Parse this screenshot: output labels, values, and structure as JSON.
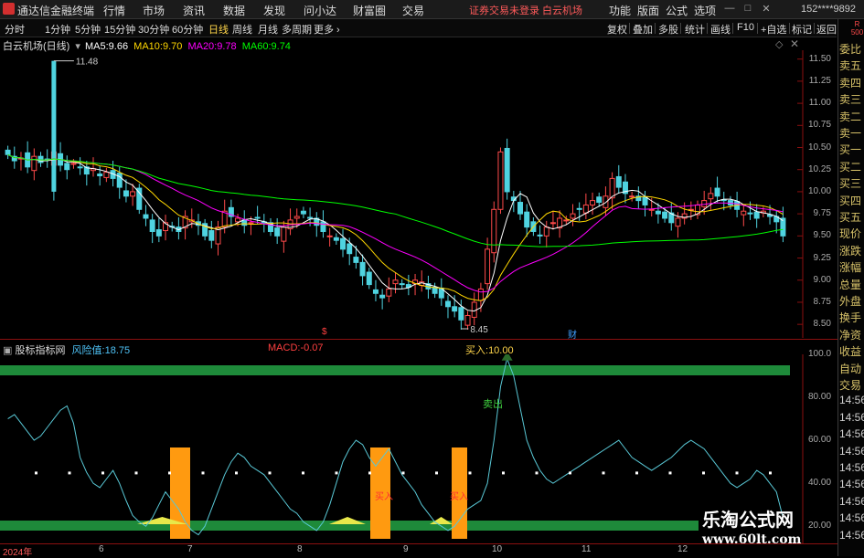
{
  "app": {
    "title": "通达信金融终端",
    "menu": [
      "行情",
      "市场",
      "资讯",
      "数据",
      "发现",
      "问小达",
      "财富圈",
      "交易"
    ],
    "notice": "证券交易未登录  白云机场",
    "right_menu": [
      "功能",
      "版面",
      "公式",
      "选项"
    ],
    "phone": "152****9892",
    "window_buttons": [
      "—",
      "□",
      "✕"
    ]
  },
  "toolbar": {
    "periods": [
      "分时",
      "1分钟",
      "5分钟",
      "15分钟",
      "30分钟",
      "60分钟",
      "日线",
      "周线",
      "月线",
      "多周期",
      "更多 ›"
    ],
    "active_period": "日线",
    "right_buttons": [
      "复权",
      "叠加",
      "多股",
      "统计",
      "画线",
      "F10",
      "+自选",
      "标记",
      "返回"
    ]
  },
  "main_chart": {
    "stock_label": "白云机场(日线)",
    "ma": [
      {
        "label": "MA5:",
        "value": "9.66",
        "color": "#ffffff"
      },
      {
        "label": "MA10:",
        "value": "9.70",
        "color": "#ffd700"
      },
      {
        "label": "MA20:",
        "value": "9.78",
        "color": "#ff00ff"
      },
      {
        "label": "MA60:",
        "value": "9.74",
        "color": "#00ff00"
      }
    ],
    "high_marker": "11.48",
    "low_marker": "8.45",
    "event_markers": [
      "$",
      "财"
    ]
  },
  "indicator_panel": {
    "title": "股标指标网",
    "risk_label": "风险值:",
    "risk_value": "18.75",
    "macd_label": "MACD:",
    "macd_value": "-0.07",
    "buy_label": "买入:",
    "buy_value": "10.00",
    "annotations": {
      "sell": "卖出",
      "buy": "买入"
    }
  },
  "right_panel": {
    "badge": [
      "R",
      "500"
    ],
    "labels": [
      "委比",
      "卖五",
      "卖四",
      "卖三",
      "卖二",
      "卖一",
      "买一",
      "买二",
      "买三",
      "买四",
      "买五",
      "现价",
      "涨跌",
      "涨幅",
      "总量",
      "外盘",
      "换手",
      "净资",
      "收益",
      "自动",
      "交易",
      "14:56",
      "14:56",
      "14:56",
      "14:56",
      "14:56",
      "14:56",
      "14:56",
      "14:56",
      "14:56"
    ]
  },
  "y_axis_main": [
    "11.50",
    "11.25",
    "11.00",
    "10.75",
    "10.50",
    "10.25",
    "10.00",
    "9.75",
    "9.50",
    "9.25",
    "9.00",
    "8.75",
    "8.50"
  ],
  "y_axis_ind": [
    "100.0",
    "80.00",
    "60.00",
    "40.00",
    "20.00"
  ],
  "x_axis": [
    "2024年",
    "6",
    "7",
    "8",
    "9",
    "10",
    "11",
    "12"
  ],
  "watermark": {
    "line1": "乐淘公式网",
    "line2": "www.60lt.com"
  },
  "chart_data": {
    "type": "candlestick",
    "title": "白云机场(日线)",
    "y_range": [
      8.45,
      11.5
    ],
    "price_summary": {
      "high": 11.48,
      "low": 8.45,
      "last_ma5": 9.66,
      "last_ma10": 9.7,
      "last_ma20": 9.78,
      "last_ma60": 9.74
    },
    "close_series": [
      10.42,
      10.35,
      10.38,
      10.28,
      10.4,
      10.33,
      10.36,
      10.45,
      10.3,
      10.25,
      10.32,
      10.28,
      10.2,
      10.26,
      10.18,
      10.22,
      10.15,
      10.05,
      9.95,
      10.0,
      9.8,
      9.7,
      9.55,
      9.5,
      9.65,
      9.6,
      9.55,
      9.72,
      9.68,
      9.62,
      9.5,
      9.45,
      9.6,
      9.78,
      9.72,
      9.7,
      9.62,
      9.65,
      9.7,
      9.65,
      9.55,
      9.5,
      9.6,
      9.68,
      9.72,
      9.75,
      9.7,
      9.62,
      9.55,
      9.5,
      9.45,
      9.35,
      9.3,
      9.2,
      9.05,
      8.95,
      8.85,
      8.8,
      8.9,
      9.0,
      8.95,
      8.92,
      9.0,
      8.98,
      8.9,
      8.85,
      8.8,
      8.7,
      8.65,
      8.55,
      8.6,
      8.75,
      8.9,
      9.35,
      9.8,
      10.45,
      10.0,
      9.9,
      9.75,
      9.6,
      9.55,
      9.5,
      9.6,
      9.65,
      9.7,
      9.68,
      9.75,
      9.8,
      9.85,
      9.9,
      9.88,
      9.95,
      10.15,
      10.05,
      9.98,
      9.95,
      9.9,
      9.85,
      9.8,
      9.75,
      9.7,
      9.65,
      9.7,
      9.75,
      9.8,
      9.85,
      9.9,
      9.98,
      9.95,
      9.9,
      9.85,
      9.8,
      9.78,
      9.75,
      9.7,
      9.78,
      9.72,
      9.66,
      9.5
    ],
    "indicator": {
      "name": "风险值",
      "y_range": [
        15,
        100
      ],
      "values": [
        70,
        72,
        68,
        64,
        60,
        62,
        66,
        70,
        74,
        76,
        68,
        52,
        45,
        40,
        38,
        42,
        46,
        40,
        32,
        25,
        22,
        20,
        24,
        30,
        36,
        32,
        28,
        22,
        18,
        16,
        20,
        28,
        36,
        44,
        50,
        54,
        52,
        48,
        46,
        44,
        40,
        36,
        32,
        28,
        26,
        22,
        20,
        18,
        22,
        30,
        40,
        50,
        56,
        60,
        58,
        52,
        48,
        52,
        56,
        50,
        44,
        40,
        36,
        30,
        26,
        22,
        20,
        18,
        20,
        24,
        28,
        30,
        32,
        40,
        60,
        85,
        98,
        90,
        75,
        60,
        52,
        46,
        42,
        40,
        42,
        44,
        46,
        48,
        50,
        52,
        54,
        56,
        58,
        60,
        56,
        52,
        50,
        48,
        46,
        48,
        50,
        52,
        55,
        58,
        60,
        58,
        56,
        52,
        48,
        44,
        40,
        38,
        40,
        42,
        46,
        44,
        40,
        36,
        24
      ],
      "buy_signal_bars": [
        [
          "7月初",
          ""
        ],
        [
          "9月初",
          ""
        ],
        [
          "9月末",
          ""
        ]
      ],
      "threshold_dots": 45
    }
  }
}
